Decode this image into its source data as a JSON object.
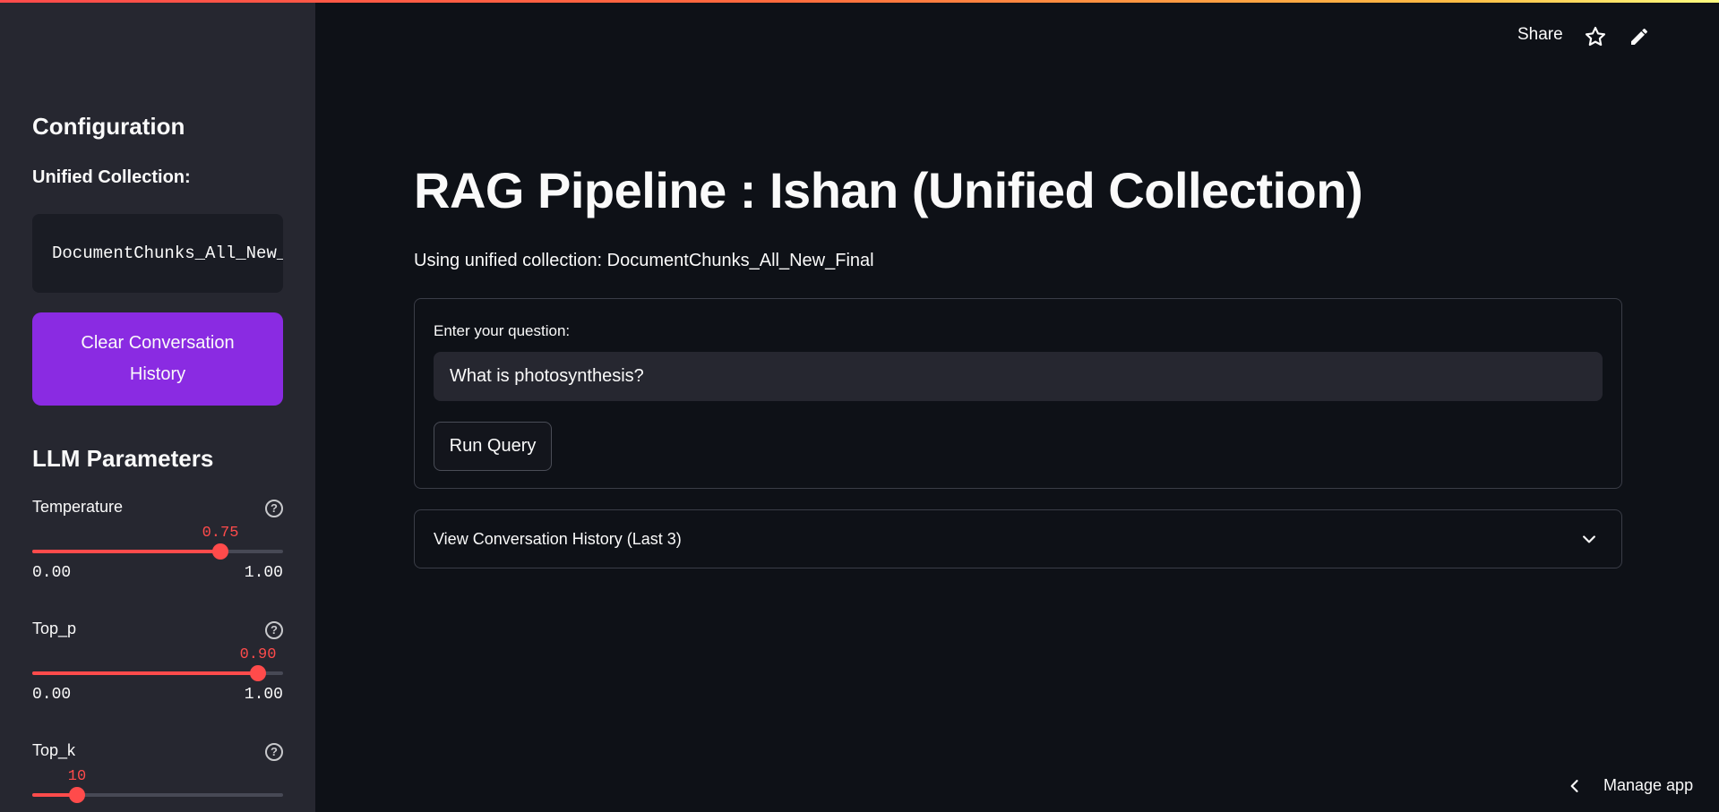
{
  "header": {
    "share_label": "Share",
    "star_icon": "star-icon",
    "edit_icon": "pencil-icon"
  },
  "sidebar": {
    "config_heading": "Configuration",
    "unified_label": "Unified Collection:",
    "collection_code": "DocumentChunks_All_New_Final",
    "clear_button": "Clear Conversation History",
    "llm_heading": "LLM Parameters",
    "sliders": [
      {
        "label": "Temperature",
        "value": "0.75",
        "fraction": 0.75,
        "min": "0.00",
        "max": "1.00"
      },
      {
        "label": "Top_p",
        "value": "0.90",
        "fraction": 0.9,
        "min": "0.00",
        "max": "1.00"
      },
      {
        "label": "Top_k",
        "value": "10",
        "fraction": 0.18,
        "min": "",
        "max": ""
      }
    ]
  },
  "main": {
    "title": "RAG Pipeline : Ishan (Unified Collection)",
    "caption": "Using unified collection: DocumentChunks_All_New_Final",
    "form": {
      "question_label": "Enter your question:",
      "question_value": "What is photosynthesis?",
      "run_button": "Run Query"
    },
    "expander_label": "View Conversation History (Last 3)"
  },
  "footer": {
    "manage_app": "Manage app"
  },
  "colors": {
    "background": "#0e1117",
    "sidebar": "#262730",
    "accent_red": "#ff4b4b",
    "button_purple": "#8a2be2"
  }
}
